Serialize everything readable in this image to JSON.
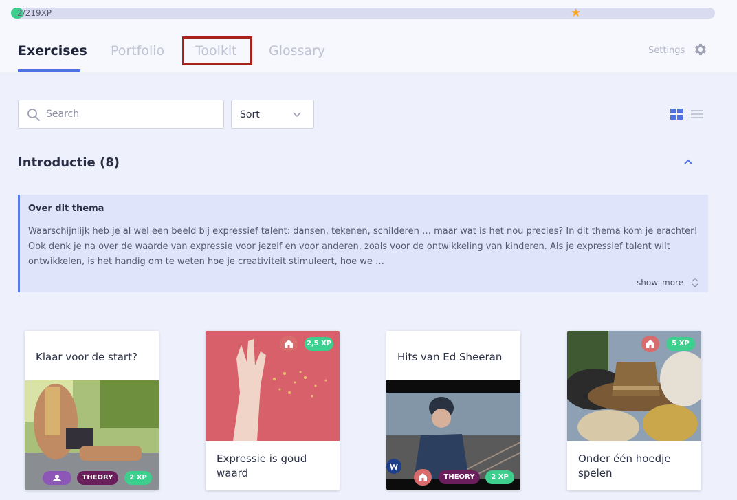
{
  "progress": {
    "text": "2/219XP",
    "fraction": 0.0091,
    "star_icon": "star-icon",
    "fill_color": "#3ecf8e"
  },
  "tabs": [
    {
      "label": "Exercises",
      "active": true
    },
    {
      "label": "Portfolio",
      "active": false
    },
    {
      "label": "Toolkit",
      "active": false,
      "highlighted": true
    },
    {
      "label": "Glossary",
      "active": false
    }
  ],
  "settings": {
    "label": "Settings",
    "icon": "gear-icon"
  },
  "search": {
    "placeholder": "Search",
    "value": ""
  },
  "sort": {
    "label": "Sort"
  },
  "view_toggle": {
    "grid_icon": "grid-view-icon",
    "list_icon": "list-view-icon",
    "active": "grid"
  },
  "section": {
    "title": "Introductie (8)",
    "expanded": true
  },
  "about": {
    "title": "Over dit thema",
    "body": "Waarschijnlijk heb je al wel een beeld bij expressief talent: dansen, tekenen, schilderen … maar wat is het nou precies? In dit thema kom je erachter! Ook denk je na over de waarde van expressie voor jezelf en voor anderen, zoals voor de ontwikkeling van kinderen. Als je expressief talent wilt ontwikkelen, is het handig om te weten hoe je creativiteit stimuleert, hoe we …",
    "show_more": "show_more"
  },
  "cards": [
    {
      "title": "Klaar voor de start?",
      "type_badge": "THEORY",
      "xp": "2 XP",
      "badge_icon": "person-icon"
    },
    {
      "title": "Expressie is goud waard",
      "xp": "2,5 XP",
      "badge_icon": "home-icon"
    },
    {
      "title": "Hits van Ed Sheeran",
      "type_badge": "THEORY",
      "xp": "2 XP",
      "badge_icon": "home-icon",
      "brand_icon": "warner-logo-icon"
    },
    {
      "title": "Onder één hoedje spelen",
      "xp": "5 XP",
      "badge_icon": "home-icon"
    }
  ],
  "colors": {
    "accent": "#4f73e3",
    "xp_green": "#3ecf8e",
    "theory_purple": "#6a1f5c",
    "person_purple": "#8d57b8",
    "home_red": "#d86b6b"
  }
}
